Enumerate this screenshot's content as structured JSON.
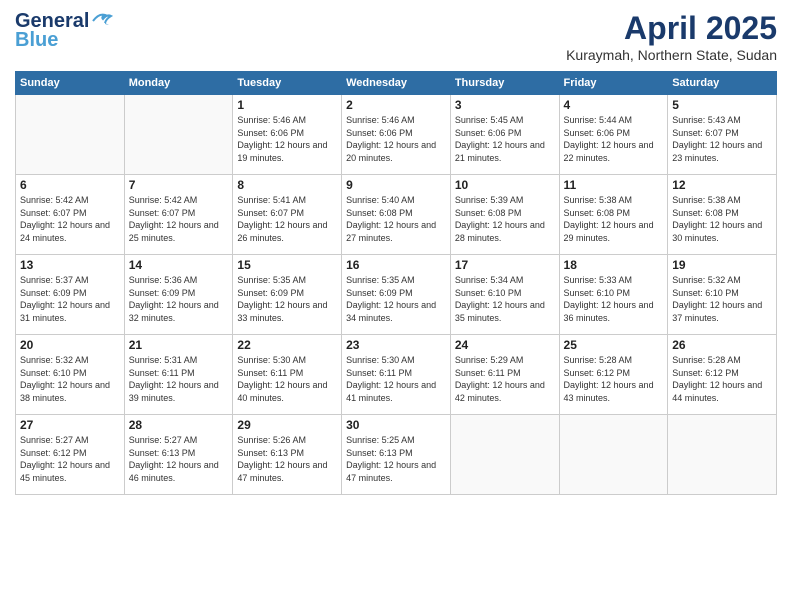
{
  "header": {
    "logo_general": "General",
    "logo_blue": "Blue",
    "month_year": "April 2025",
    "location": "Kuraymah, Northern State, Sudan"
  },
  "days_of_week": [
    "Sunday",
    "Monday",
    "Tuesday",
    "Wednesday",
    "Thursday",
    "Friday",
    "Saturday"
  ],
  "weeks": [
    [
      {
        "day": "",
        "sunrise": "",
        "sunset": "",
        "daylight": ""
      },
      {
        "day": "",
        "sunrise": "",
        "sunset": "",
        "daylight": ""
      },
      {
        "day": "1",
        "sunrise": "Sunrise: 5:46 AM",
        "sunset": "Sunset: 6:06 PM",
        "daylight": "Daylight: 12 hours and 19 minutes."
      },
      {
        "day": "2",
        "sunrise": "Sunrise: 5:46 AM",
        "sunset": "Sunset: 6:06 PM",
        "daylight": "Daylight: 12 hours and 20 minutes."
      },
      {
        "day": "3",
        "sunrise": "Sunrise: 5:45 AM",
        "sunset": "Sunset: 6:06 PM",
        "daylight": "Daylight: 12 hours and 21 minutes."
      },
      {
        "day": "4",
        "sunrise": "Sunrise: 5:44 AM",
        "sunset": "Sunset: 6:06 PM",
        "daylight": "Daylight: 12 hours and 22 minutes."
      },
      {
        "day": "5",
        "sunrise": "Sunrise: 5:43 AM",
        "sunset": "Sunset: 6:07 PM",
        "daylight": "Daylight: 12 hours and 23 minutes."
      }
    ],
    [
      {
        "day": "6",
        "sunrise": "Sunrise: 5:42 AM",
        "sunset": "Sunset: 6:07 PM",
        "daylight": "Daylight: 12 hours and 24 minutes."
      },
      {
        "day": "7",
        "sunrise": "Sunrise: 5:42 AM",
        "sunset": "Sunset: 6:07 PM",
        "daylight": "Daylight: 12 hours and 25 minutes."
      },
      {
        "day": "8",
        "sunrise": "Sunrise: 5:41 AM",
        "sunset": "Sunset: 6:07 PM",
        "daylight": "Daylight: 12 hours and 26 minutes."
      },
      {
        "day": "9",
        "sunrise": "Sunrise: 5:40 AM",
        "sunset": "Sunset: 6:08 PM",
        "daylight": "Daylight: 12 hours and 27 minutes."
      },
      {
        "day": "10",
        "sunrise": "Sunrise: 5:39 AM",
        "sunset": "Sunset: 6:08 PM",
        "daylight": "Daylight: 12 hours and 28 minutes."
      },
      {
        "day": "11",
        "sunrise": "Sunrise: 5:38 AM",
        "sunset": "Sunset: 6:08 PM",
        "daylight": "Daylight: 12 hours and 29 minutes."
      },
      {
        "day": "12",
        "sunrise": "Sunrise: 5:38 AM",
        "sunset": "Sunset: 6:08 PM",
        "daylight": "Daylight: 12 hours and 30 minutes."
      }
    ],
    [
      {
        "day": "13",
        "sunrise": "Sunrise: 5:37 AM",
        "sunset": "Sunset: 6:09 PM",
        "daylight": "Daylight: 12 hours and 31 minutes."
      },
      {
        "day": "14",
        "sunrise": "Sunrise: 5:36 AM",
        "sunset": "Sunset: 6:09 PM",
        "daylight": "Daylight: 12 hours and 32 minutes."
      },
      {
        "day": "15",
        "sunrise": "Sunrise: 5:35 AM",
        "sunset": "Sunset: 6:09 PM",
        "daylight": "Daylight: 12 hours and 33 minutes."
      },
      {
        "day": "16",
        "sunrise": "Sunrise: 5:35 AM",
        "sunset": "Sunset: 6:09 PM",
        "daylight": "Daylight: 12 hours and 34 minutes."
      },
      {
        "day": "17",
        "sunrise": "Sunrise: 5:34 AM",
        "sunset": "Sunset: 6:10 PM",
        "daylight": "Daylight: 12 hours and 35 minutes."
      },
      {
        "day": "18",
        "sunrise": "Sunrise: 5:33 AM",
        "sunset": "Sunset: 6:10 PM",
        "daylight": "Daylight: 12 hours and 36 minutes."
      },
      {
        "day": "19",
        "sunrise": "Sunrise: 5:32 AM",
        "sunset": "Sunset: 6:10 PM",
        "daylight": "Daylight: 12 hours and 37 minutes."
      }
    ],
    [
      {
        "day": "20",
        "sunrise": "Sunrise: 5:32 AM",
        "sunset": "Sunset: 6:10 PM",
        "daylight": "Daylight: 12 hours and 38 minutes."
      },
      {
        "day": "21",
        "sunrise": "Sunrise: 5:31 AM",
        "sunset": "Sunset: 6:11 PM",
        "daylight": "Daylight: 12 hours and 39 minutes."
      },
      {
        "day": "22",
        "sunrise": "Sunrise: 5:30 AM",
        "sunset": "Sunset: 6:11 PM",
        "daylight": "Daylight: 12 hours and 40 minutes."
      },
      {
        "day": "23",
        "sunrise": "Sunrise: 5:30 AM",
        "sunset": "Sunset: 6:11 PM",
        "daylight": "Daylight: 12 hours and 41 minutes."
      },
      {
        "day": "24",
        "sunrise": "Sunrise: 5:29 AM",
        "sunset": "Sunset: 6:11 PM",
        "daylight": "Daylight: 12 hours and 42 minutes."
      },
      {
        "day": "25",
        "sunrise": "Sunrise: 5:28 AM",
        "sunset": "Sunset: 6:12 PM",
        "daylight": "Daylight: 12 hours and 43 minutes."
      },
      {
        "day": "26",
        "sunrise": "Sunrise: 5:28 AM",
        "sunset": "Sunset: 6:12 PM",
        "daylight": "Daylight: 12 hours and 44 minutes."
      }
    ],
    [
      {
        "day": "27",
        "sunrise": "Sunrise: 5:27 AM",
        "sunset": "Sunset: 6:12 PM",
        "daylight": "Daylight: 12 hours and 45 minutes."
      },
      {
        "day": "28",
        "sunrise": "Sunrise: 5:27 AM",
        "sunset": "Sunset: 6:13 PM",
        "daylight": "Daylight: 12 hours and 46 minutes."
      },
      {
        "day": "29",
        "sunrise": "Sunrise: 5:26 AM",
        "sunset": "Sunset: 6:13 PM",
        "daylight": "Daylight: 12 hours and 47 minutes."
      },
      {
        "day": "30",
        "sunrise": "Sunrise: 5:25 AM",
        "sunset": "Sunset: 6:13 PM",
        "daylight": "Daylight: 12 hours and 47 minutes."
      },
      {
        "day": "",
        "sunrise": "",
        "sunset": "",
        "daylight": ""
      },
      {
        "day": "",
        "sunrise": "",
        "sunset": "",
        "daylight": ""
      },
      {
        "day": "",
        "sunrise": "",
        "sunset": "",
        "daylight": ""
      }
    ]
  ]
}
